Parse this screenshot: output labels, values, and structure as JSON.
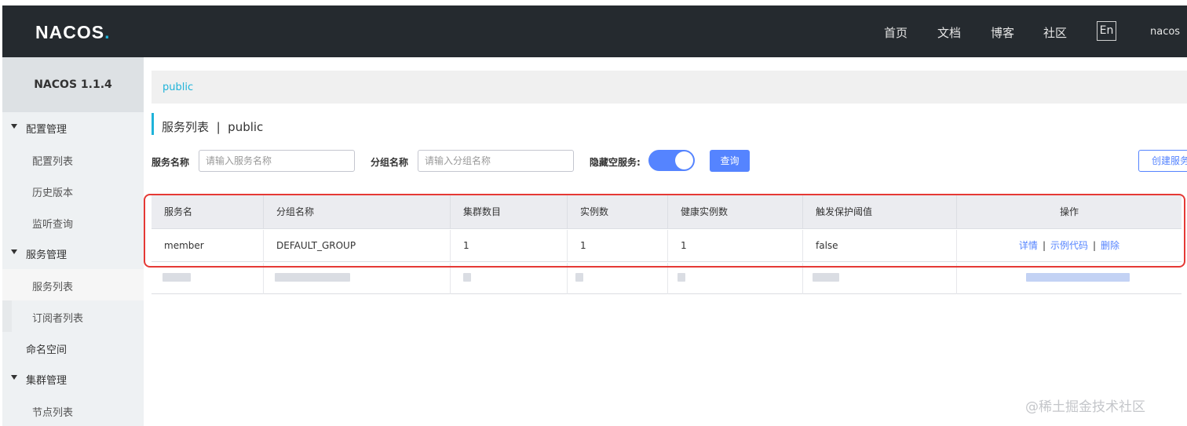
{
  "header": {
    "logo": "NACOS",
    "logo_dot": ".",
    "nav": [
      "首页",
      "文档",
      "博客",
      "社区"
    ],
    "lang": "En",
    "user": "nacos"
  },
  "sidebar": {
    "version": "NACOS 1.1.4",
    "groups": [
      {
        "label": "配置管理",
        "items": [
          "配置列表",
          "历史版本",
          "监听查询"
        ]
      },
      {
        "label": "服务管理",
        "items": [
          "服务列表",
          "订阅者列表"
        ]
      },
      {
        "label": "命名空间"
      },
      {
        "label": "集群管理",
        "items": [
          "节点列表"
        ]
      }
    ],
    "active_item": "服务列表"
  },
  "breadcrumb": {
    "namespace": "public"
  },
  "page": {
    "title": "服务列表",
    "separator": "|",
    "namespace": "public"
  },
  "filters": {
    "service_name_label": "服务名称",
    "service_name_placeholder": "请输入服务名称",
    "group_name_label": "分组名称",
    "group_name_placeholder": "请输入分组名称",
    "hide_empty_label": "隐藏空服务:",
    "hide_empty_on": true,
    "query_button": "查询",
    "create_button": "创建服务"
  },
  "table": {
    "columns": [
      "服务名",
      "分组名称",
      "集群数目",
      "实例数",
      "健康实例数",
      "触发保护阈值",
      "操作"
    ],
    "rows": [
      {
        "service": "member",
        "group": "DEFAULT_GROUP",
        "clusters": "1",
        "instances": "1",
        "healthy": "1",
        "threshold": "false",
        "ops": [
          "详情",
          "示例代码",
          "删除"
        ]
      }
    ]
  },
  "watermark": "@稀土掘金技术社区",
  "colors": {
    "header_bg": "#252a2f",
    "accent": "#1fb3d9",
    "primary": "#5584ff",
    "highlight": "#e53935"
  }
}
